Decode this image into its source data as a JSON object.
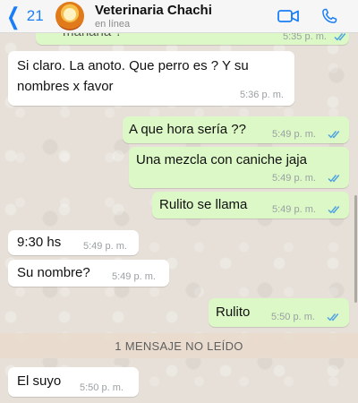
{
  "header": {
    "back_count": "21",
    "contact_name": "Veterinaria Chachi",
    "status": "en línea",
    "icons": [
      "chevron-left-icon",
      "video-call-icon",
      "phone-icon"
    ],
    "accent_color": "#1a7ef7"
  },
  "messages": [
    {
      "direction": "out",
      "text": "mañana ?",
      "time": "5:35 p. m.",
      "read": true
    },
    {
      "direction": "in",
      "lines": [
        "Si claro. La anoto. Que perro es ? Y su",
        "nombres x favor"
      ],
      "time": "5:36 p. m."
    },
    {
      "direction": "out",
      "text": "A que hora sería ??",
      "time": "5:49 p. m.",
      "read": true
    },
    {
      "direction": "out",
      "text": "Una mezcla con caniche jaja",
      "time": "5:49 p. m.",
      "read": true
    },
    {
      "direction": "out",
      "text": "Rulito se llama",
      "time": "5:49 p. m.",
      "read": true
    },
    {
      "direction": "in",
      "text": "9:30 hs",
      "time": "5:49 p. m."
    },
    {
      "direction": "in",
      "text": "Su nombre?",
      "time": "5:49 p. m."
    },
    {
      "direction": "out",
      "text": "Rulito",
      "time": "5:50 p. m.",
      "read": true
    },
    {
      "direction": "in",
      "text": "El suyo",
      "time": "5:50 p. m."
    }
  ],
  "unread_banner": "1 MENSAJE NO LEÍDO",
  "colors": {
    "incoming_bubble": "#ffffff",
    "outgoing_bubble": "#dcf8c6",
    "read_ticks": "#4fa3e0"
  }
}
